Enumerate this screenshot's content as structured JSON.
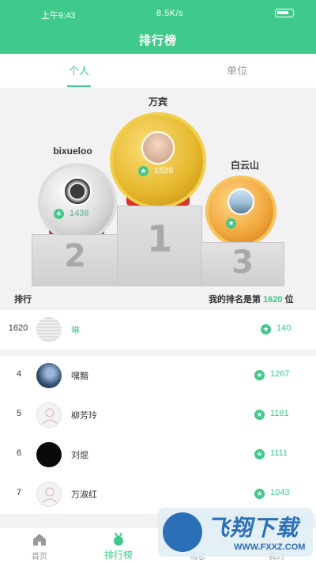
{
  "status": {
    "time": "上午9:43",
    "network": "8.5K/s"
  },
  "header": {
    "title": "排行榜"
  },
  "tabs": [
    {
      "label": "个人"
    },
    {
      "label": "单位"
    }
  ],
  "podium": {
    "first": {
      "name": "万宾",
      "score": "1520",
      "place": "1"
    },
    "second": {
      "name": "bixueloo",
      "score": "1438",
      "place": "2"
    },
    "third": {
      "name": "白云山",
      "score": "",
      "place": "3"
    }
  },
  "rank_header": {
    "left": "排行",
    "my_rank_prefix": "我的排名是第",
    "my_rank": "1620",
    "my_rank_suffix": "位"
  },
  "my_row": {
    "rank": "1620",
    "name": "琳",
    "score": "140"
  },
  "rows": [
    {
      "rank": "4",
      "name": "嘿黯",
      "score": "1267"
    },
    {
      "rank": "5",
      "name": "柳芳玲",
      "score": "1181"
    },
    {
      "rank": "6",
      "name": "刘焜",
      "score": "1111"
    },
    {
      "rank": "7",
      "name": "万淑红",
      "score": "1043"
    }
  ],
  "nav": [
    {
      "label": "首页"
    },
    {
      "label": "排行榜"
    },
    {
      "label": "消息"
    },
    {
      "label": "我的"
    }
  ],
  "watermark": {
    "title": "飞翔下载",
    "url": "WWW.FXXZ.COM"
  },
  "colors": {
    "accent": "#3fc98a",
    "gold": "#e5b62a",
    "silver": "#c9c9c9",
    "ribbon": "#d9342b"
  }
}
